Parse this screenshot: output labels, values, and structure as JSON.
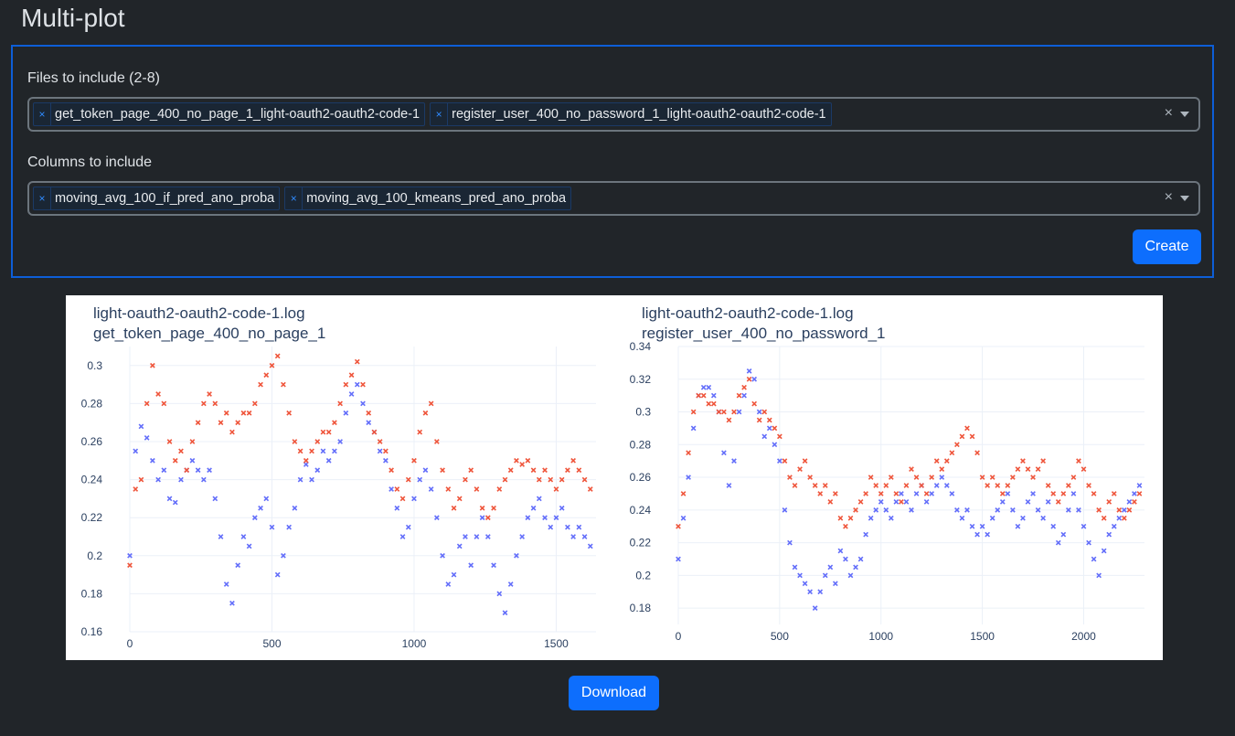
{
  "page": {
    "title": "Multi-plot"
  },
  "form": {
    "files_label": "Files to include (2-8)",
    "files": [
      "get_token_page_400_no_page_1_light-oauth2-oauth2-code-1",
      "register_user_400_no_password_1_light-oauth2-oauth2-code-1"
    ],
    "columns_label": "Columns to include",
    "columns": [
      "moving_avg_100_if_pred_ano_proba",
      "moving_avg_100_kmeans_pred_ano_proba"
    ],
    "tag_remove_glyph": "×",
    "clear_glyph": "×",
    "create_label": "Create"
  },
  "download_label": "Download",
  "colors": {
    "series_if": "#636efa",
    "series_kmeans": "#ef553b",
    "accent": "#0d6efd"
  },
  "chart_data": [
    {
      "type": "scatter",
      "title": "light-oauth2-oauth2-code-1.log",
      "subtitle": "get_token_page_400_no_page_1",
      "xlim": [
        0,
        1640
      ],
      "ylim": [
        0.16,
        0.31
      ],
      "xticks": [
        0,
        500,
        1000,
        1500
      ],
      "yticks": [
        0.16,
        0.18,
        0.2,
        0.22,
        0.24,
        0.26,
        0.28,
        0.3
      ],
      "grid": true,
      "marker": "x",
      "series": [
        {
          "color": "#636efa",
          "x": [
            0,
            20,
            40,
            60,
            80,
            100,
            120,
            140,
            160,
            180,
            200,
            220,
            240,
            260,
            280,
            300,
            320,
            340,
            360,
            380,
            400,
            420,
            440,
            460,
            480,
            500,
            520,
            540,
            560,
            580,
            600,
            620,
            640,
            660,
            680,
            700,
            720,
            740,
            760,
            780,
            800,
            820,
            840,
            860,
            880,
            900,
            920,
            940,
            960,
            980,
            1000,
            1020,
            1040,
            1060,
            1080,
            1100,
            1120,
            1140,
            1160,
            1180,
            1200,
            1220,
            1240,
            1260,
            1280,
            1300,
            1320,
            1340,
            1360,
            1380,
            1400,
            1420,
            1440,
            1460,
            1480,
            1500,
            1520,
            1540,
            1560,
            1580,
            1600,
            1620
          ],
          "y": [
            0.2,
            0.255,
            0.268,
            0.262,
            0.25,
            0.24,
            0.245,
            0.23,
            0.228,
            0.24,
            0.245,
            0.25,
            0.245,
            0.24,
            0.245,
            0.23,
            0.21,
            0.185,
            0.175,
            0.195,
            0.21,
            0.205,
            0.22,
            0.225,
            0.23,
            0.215,
            0.19,
            0.2,
            0.215,
            0.225,
            0.24,
            0.248,
            0.24,
            0.245,
            0.255,
            0.25,
            0.255,
            0.26,
            0.275,
            0.285,
            0.29,
            0.28,
            0.27,
            0.265,
            0.255,
            0.25,
            0.235,
            0.225,
            0.21,
            0.215,
            0.23,
            0.24,
            0.245,
            0.235,
            0.22,
            0.2,
            0.185,
            0.19,
            0.205,
            0.21,
            0.195,
            0.21,
            0.22,
            0.21,
            0.195,
            0.18,
            0.17,
            0.185,
            0.2,
            0.21,
            0.22,
            0.225,
            0.23,
            0.22,
            0.215,
            0.22,
            0.225,
            0.215,
            0.21,
            0.215,
            0.21,
            0.205
          ]
        },
        {
          "color": "#ef553b",
          "x": [
            0,
            20,
            40,
            60,
            80,
            100,
            120,
            140,
            160,
            180,
            200,
            220,
            240,
            260,
            280,
            300,
            320,
            340,
            360,
            380,
            400,
            420,
            440,
            460,
            480,
            500,
            520,
            540,
            560,
            580,
            600,
            620,
            640,
            660,
            680,
            700,
            720,
            740,
            760,
            780,
            800,
            820,
            840,
            860,
            880,
            900,
            920,
            940,
            960,
            980,
            1000,
            1020,
            1040,
            1060,
            1080,
            1100,
            1120,
            1140,
            1160,
            1180,
            1200,
            1220,
            1240,
            1260,
            1280,
            1300,
            1320,
            1340,
            1360,
            1380,
            1400,
            1420,
            1440,
            1460,
            1480,
            1500,
            1520,
            1540,
            1560,
            1580,
            1600,
            1620
          ],
          "y": [
            0.195,
            0.235,
            0.24,
            0.28,
            0.3,
            0.285,
            0.28,
            0.26,
            0.25,
            0.255,
            0.245,
            0.26,
            0.27,
            0.28,
            0.285,
            0.28,
            0.27,
            0.275,
            0.265,
            0.27,
            0.275,
            0.275,
            0.28,
            0.29,
            0.295,
            0.3,
            0.305,
            0.29,
            0.275,
            0.26,
            0.255,
            0.25,
            0.255,
            0.26,
            0.265,
            0.265,
            0.27,
            0.28,
            0.29,
            0.295,
            0.302,
            0.29,
            0.275,
            0.265,
            0.26,
            0.255,
            0.245,
            0.235,
            0.23,
            0.24,
            0.25,
            0.265,
            0.275,
            0.28,
            0.26,
            0.245,
            0.235,
            0.225,
            0.23,
            0.24,
            0.245,
            0.235,
            0.225,
            0.22,
            0.225,
            0.235,
            0.24,
            0.245,
            0.25,
            0.248,
            0.25,
            0.245,
            0.24,
            0.245,
            0.24,
            0.235,
            0.24,
            0.245,
            0.25,
            0.245,
            0.24,
            0.235
          ]
        }
      ]
    },
    {
      "type": "scatter",
      "title": "light-oauth2-oauth2-code-1.log",
      "subtitle": "register_user_400_no_password_1",
      "xlim": [
        0,
        2300
      ],
      "ylim": [
        0.17,
        0.34
      ],
      "xticks": [
        0,
        500,
        1000,
        1500,
        2000
      ],
      "yticks": [
        0.18,
        0.2,
        0.22,
        0.24,
        0.26,
        0.28,
        0.3,
        0.32,
        0.34
      ],
      "grid": true,
      "marker": "x",
      "series": [
        {
          "color": "#636efa",
          "x": [
            0,
            25,
            50,
            75,
            100,
            125,
            150,
            175,
            200,
            225,
            250,
            275,
            300,
            325,
            350,
            375,
            400,
            425,
            450,
            475,
            500,
            525,
            550,
            575,
            600,
            625,
            650,
            675,
            700,
            725,
            750,
            775,
            800,
            825,
            850,
            875,
            900,
            925,
            950,
            975,
            1000,
            1025,
            1050,
            1075,
            1100,
            1125,
            1150,
            1175,
            1200,
            1225,
            1250,
            1275,
            1300,
            1325,
            1350,
            1375,
            1400,
            1425,
            1450,
            1475,
            1500,
            1525,
            1550,
            1575,
            1600,
            1625,
            1650,
            1675,
            1700,
            1725,
            1750,
            1775,
            1800,
            1825,
            1850,
            1875,
            1900,
            1925,
            1950,
            1975,
            2000,
            2025,
            2050,
            2075,
            2100,
            2125,
            2150,
            2175,
            2200,
            2225,
            2250,
            2275
          ],
          "y": [
            0.21,
            0.235,
            0.26,
            0.29,
            0.31,
            0.315,
            0.315,
            0.31,
            0.3,
            0.275,
            0.255,
            0.27,
            0.3,
            0.31,
            0.325,
            0.32,
            0.3,
            0.285,
            0.29,
            0.28,
            0.27,
            0.24,
            0.22,
            0.205,
            0.2,
            0.195,
            0.19,
            0.18,
            0.19,
            0.2,
            0.205,
            0.195,
            0.215,
            0.21,
            0.2,
            0.205,
            0.21,
            0.225,
            0.235,
            0.24,
            0.245,
            0.24,
            0.235,
            0.245,
            0.25,
            0.245,
            0.24,
            0.25,
            0.255,
            0.245,
            0.25,
            0.255,
            0.26,
            0.255,
            0.25,
            0.24,
            0.235,
            0.24,
            0.23,
            0.225,
            0.23,
            0.225,
            0.235,
            0.24,
            0.245,
            0.25,
            0.24,
            0.23,
            0.235,
            0.245,
            0.25,
            0.24,
            0.235,
            0.245,
            0.23,
            0.22,
            0.225,
            0.24,
            0.25,
            0.24,
            0.23,
            0.22,
            0.21,
            0.2,
            0.215,
            0.225,
            0.23,
            0.235,
            0.24,
            0.245,
            0.25,
            0.255
          ]
        },
        {
          "color": "#ef553b",
          "x": [
            0,
            25,
            50,
            75,
            100,
            125,
            150,
            175,
            200,
            225,
            250,
            275,
            300,
            325,
            350,
            375,
            400,
            425,
            450,
            475,
            500,
            525,
            550,
            575,
            600,
            625,
            650,
            675,
            700,
            725,
            750,
            775,
            800,
            825,
            850,
            875,
            900,
            925,
            950,
            975,
            1000,
            1025,
            1050,
            1075,
            1100,
            1125,
            1150,
            1175,
            1200,
            1225,
            1250,
            1275,
            1300,
            1325,
            1350,
            1375,
            1400,
            1425,
            1450,
            1475,
            1500,
            1525,
            1550,
            1575,
            1600,
            1625,
            1650,
            1675,
            1700,
            1725,
            1750,
            1775,
            1800,
            1825,
            1850,
            1875,
            1900,
            1925,
            1950,
            1975,
            2000,
            2025,
            2050,
            2075,
            2100,
            2125,
            2150,
            2175,
            2200,
            2225,
            2250,
            2275
          ],
          "y": [
            0.23,
            0.25,
            0.275,
            0.3,
            0.31,
            0.31,
            0.305,
            0.305,
            0.3,
            0.3,
            0.295,
            0.3,
            0.31,
            0.315,
            0.32,
            0.305,
            0.295,
            0.3,
            0.295,
            0.29,
            0.285,
            0.27,
            0.26,
            0.255,
            0.265,
            0.27,
            0.26,
            0.255,
            0.25,
            0.255,
            0.245,
            0.25,
            0.235,
            0.23,
            0.235,
            0.24,
            0.245,
            0.25,
            0.26,
            0.255,
            0.25,
            0.255,
            0.26,
            0.25,
            0.245,
            0.255,
            0.265,
            0.26,
            0.255,
            0.25,
            0.26,
            0.27,
            0.265,
            0.27,
            0.275,
            0.28,
            0.285,
            0.29,
            0.285,
            0.275,
            0.26,
            0.255,
            0.26,
            0.255,
            0.25,
            0.255,
            0.26,
            0.265,
            0.27,
            0.265,
            0.26,
            0.265,
            0.27,
            0.255,
            0.25,
            0.245,
            0.25,
            0.255,
            0.26,
            0.27,
            0.265,
            0.255,
            0.25,
            0.24,
            0.235,
            0.245,
            0.25,
            0.24,
            0.235,
            0.24,
            0.245,
            0.25
          ]
        }
      ]
    }
  ]
}
